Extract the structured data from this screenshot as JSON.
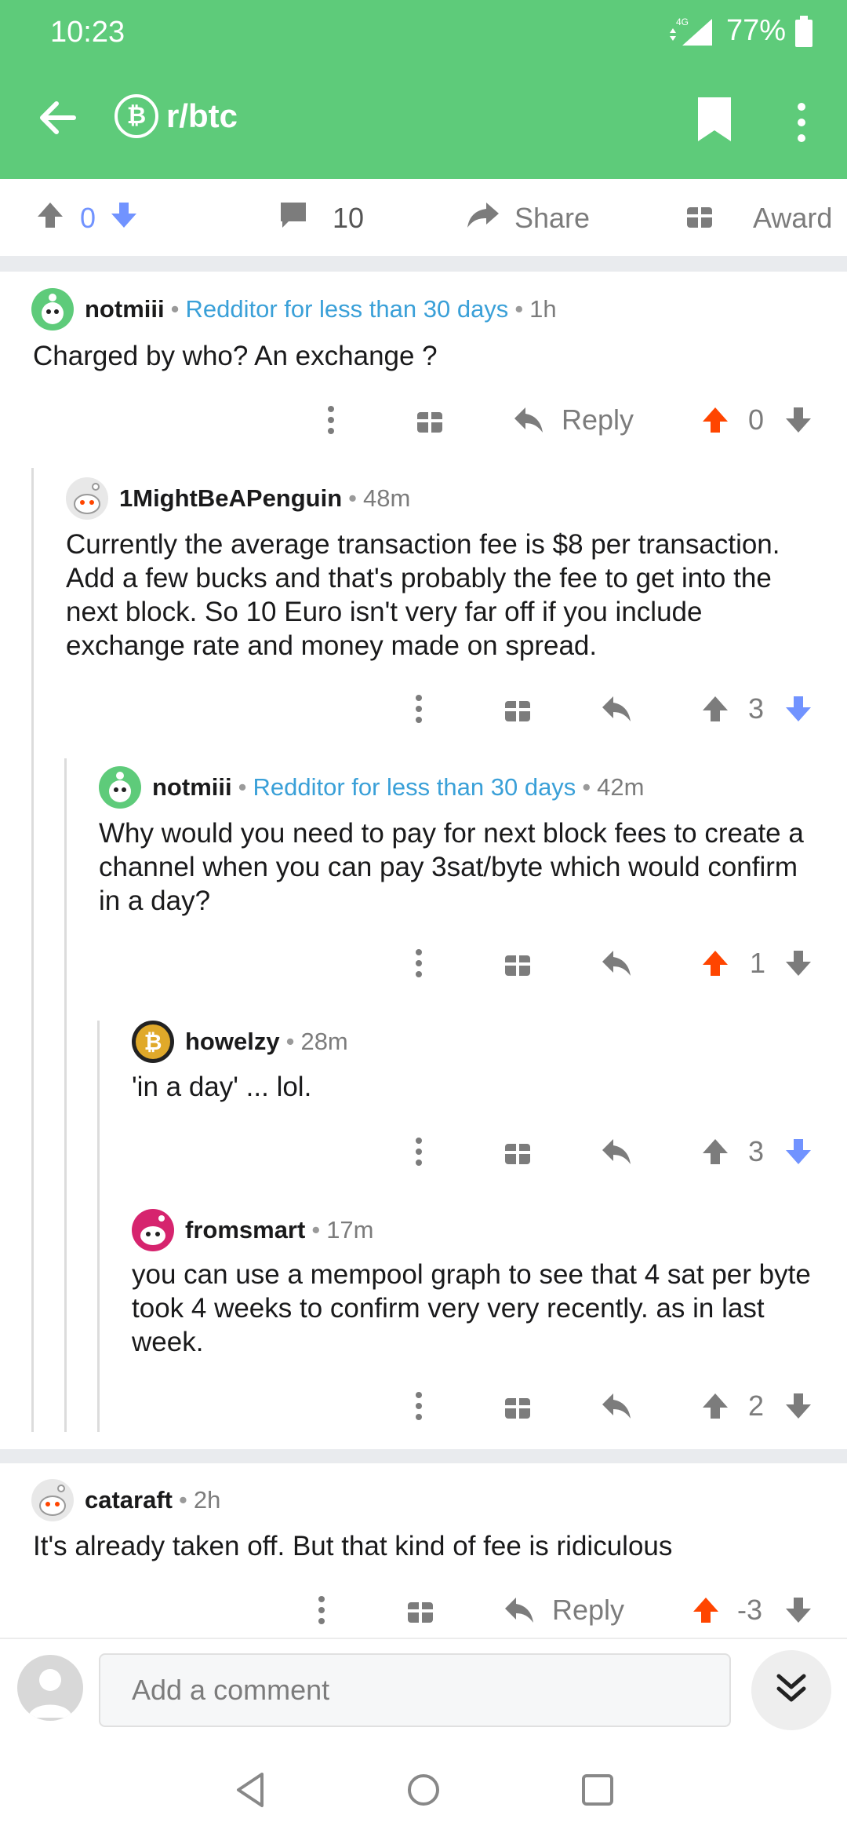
{
  "status_bar": {
    "time": "10:23",
    "network": "4G",
    "battery": "77%"
  },
  "toolbar": {
    "subreddit": "r/btc",
    "subreddit_icon": "bitcoin-icon"
  },
  "post_actions": {
    "score": "0",
    "comments": "10",
    "share": "Share",
    "award": "Award"
  },
  "comments": [
    {
      "user": "notmiii",
      "flair": "Redditor for less than 30 days",
      "age": "1h",
      "body": "Charged by who? An exchange ?",
      "reply": "Reply",
      "score": "0",
      "vote": "up"
    },
    {
      "user": "1MightBeAPenguin",
      "age": "48m",
      "body": "Currently the average transaction fee is $8 per transaction. Add a few bucks and that's probably the fee to get into the next block. So 10 Euro isn't very far off if you include exchange rate and money made on spread.",
      "score": "3",
      "vote": "down"
    },
    {
      "user": "notmiii",
      "flair": "Redditor for less than 30 days",
      "age": "42m",
      "body": "Why would you need to pay for next block fees to create a channel when you can pay 3sat/byte which would confirm in a day?",
      "score": "1",
      "vote": "up"
    },
    {
      "user": "howelzy",
      "age": "28m",
      "body": "'in a day' ... lol.",
      "score": "3",
      "vote": "down"
    },
    {
      "user": "fromsmart",
      "age": "17m",
      "body": "you can use a mempool graph to see that 4 sat per byte took 4 weeks to confirm very very recently. as in last week.",
      "score": "2",
      "vote": "none"
    },
    {
      "user": "cataraft",
      "age": "2h",
      "body": "It's already taken off. But that kind of fee is ridiculous",
      "reply": "Reply",
      "score": "-3",
      "vote": "up"
    }
  ],
  "composer": {
    "placeholder": "Add a comment"
  },
  "colors": {
    "header": "#5ecb7a",
    "upvote": "#ff4500",
    "downvote": "#7193ff",
    "flair": "#3aa0d8"
  }
}
